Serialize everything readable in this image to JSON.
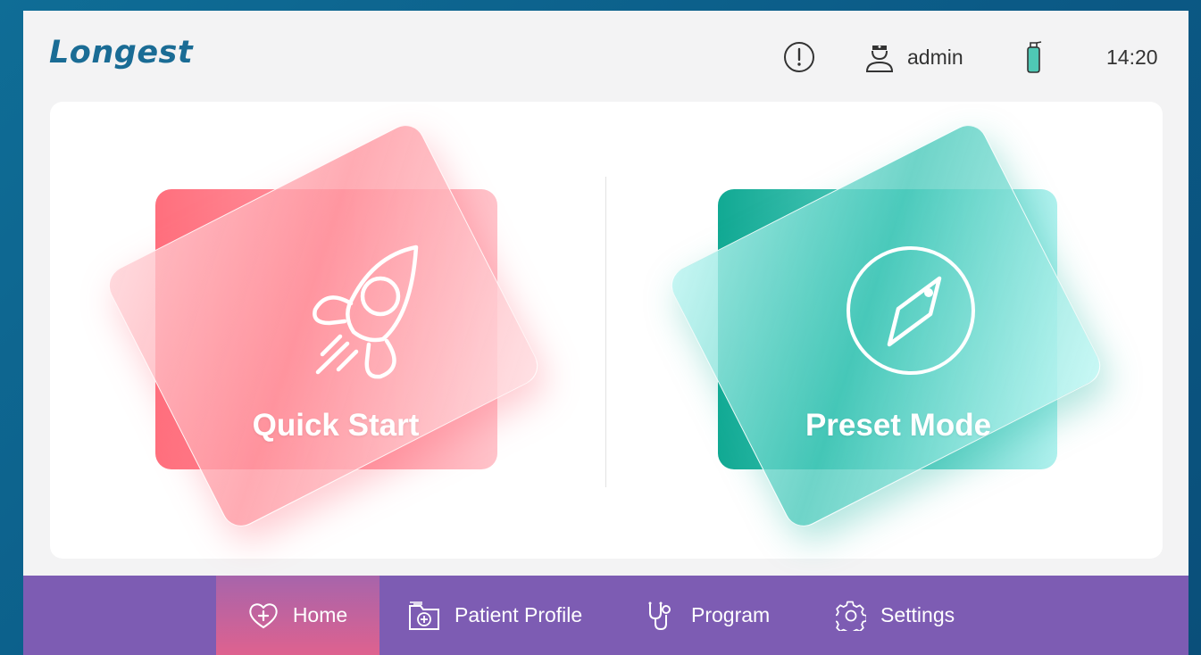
{
  "header": {
    "brand": "Longest",
    "alert_icon": "exclamation-circle-icon",
    "user_icon": "doctor-icon",
    "user_name": "admin",
    "bottle_icon": "fluid-bottle-icon",
    "time": "14:20"
  },
  "main": {
    "tiles": [
      {
        "label": "Quick Start",
        "icon": "rocket-icon",
        "color": "#ff6f7d"
      },
      {
        "label": "Preset Mode",
        "icon": "compass-icon",
        "color": "#11a993"
      }
    ]
  },
  "nav": {
    "items": [
      {
        "label": "Home",
        "icon": "heart-plus-icon",
        "active": true
      },
      {
        "label": "Patient Profile",
        "icon": "folder-plus-icon",
        "active": false
      },
      {
        "label": "Program",
        "icon": "stethoscope-icon",
        "active": false
      },
      {
        "label": "Settings",
        "icon": "gear-icon",
        "active": false
      }
    ]
  },
  "colors": {
    "brand": "#1a6c95",
    "nav_bg": "#7d5cb3",
    "nav_active": "#de628f",
    "bottle": "#4fc8b5"
  }
}
